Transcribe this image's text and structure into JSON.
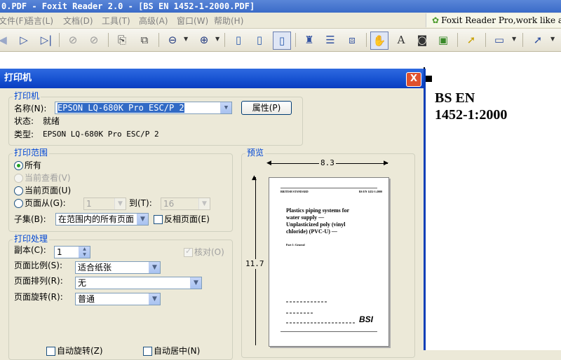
{
  "app": {
    "title_bar": "0.PDF - Foxit Reader 2.0 - [BS EN 1452-1-2000.PDF]",
    "menus": [
      "文件(F)",
      "语言(L)",
      "文档(D)",
      "工具(T)",
      "高级(A)",
      "窗口(W)",
      "帮助(H)"
    ],
    "promo": "Foxit Reader Pro,work like a pro!"
  },
  "toolbar": {
    "icons": [
      "prev-page-icon",
      "next-page-icon",
      "last-page-icon",
      "back-icon",
      "forward-icon",
      "extract-page-icon",
      "rotate-page-icon",
      "zoom-out-icon",
      "zoom-in-icon",
      "actual-size-icon",
      "fit-page-icon",
      "fit-width-icon",
      "find-icon",
      "bookmarks-icon",
      "thumbnail-icon",
      "hand-tool-icon",
      "text-select-icon",
      "snapshot-icon",
      "image-icon",
      "select-arrow-icon",
      "annotation-icon",
      "link-tool-icon"
    ]
  },
  "document": {
    "title_line1": "BS EN",
    "title_line2": "1452-1:2000"
  },
  "dialog": {
    "title": "打印机",
    "close_label": "X",
    "printer": {
      "group_label": "打印机",
      "name_label": "名称(N):",
      "name_value": "EPSON LQ-680K Pro ESC/P 2",
      "properties_button": "属性(P)",
      "status_label": "状态:",
      "status_value": "就绪",
      "type_label": "类型:",
      "type_value": "EPSON LQ-680K Pro ESC/P 2"
    },
    "range": {
      "group_label": "打印范围",
      "all_label": "所有",
      "current_view_label": "当前查看(V)",
      "current_page_label": "当前页面(U)",
      "pages_from_label": "页面从(G):",
      "from_value": "1",
      "to_label": "到(T):",
      "to_value": "16",
      "subset_label": "子集(B):",
      "subset_value": "在范围内的所有页面",
      "reverse_label": "反相页面(E)"
    },
    "handling": {
      "group_label": "打印处理",
      "copies_label": "副本(C):",
      "copies_value": "1",
      "collate_label": "核对(O)",
      "scale_label": "页面比例(S):",
      "scale_value": "适合纸张",
      "arrange_label": "页面排列(R):",
      "arrange_value": "无",
      "rotate_label": "页面旋转(R):",
      "rotate_value": "普通",
      "auto_rotate_label": "自动旋转(Z)",
      "auto_center_label": "自动居中(N)"
    },
    "preview": {
      "group_label": "预览",
      "width": "8.3",
      "height": "11.7",
      "page_title": "Plastics piping systems for water supply — Unplasticized poly (vinyl chloride) (PVC-U) —",
      "page_part": "Part 1: General",
      "page_header_left": "BRITISH STANDARD",
      "page_header_right": "BS EN 1452-1:2000",
      "page_logo": "BSI"
    }
  },
  "colors": {
    "title_bar": "#3A6BC8",
    "dialog_title": "#1550D0",
    "group_label": "#0046D5",
    "close_button": "#E0512F"
  }
}
